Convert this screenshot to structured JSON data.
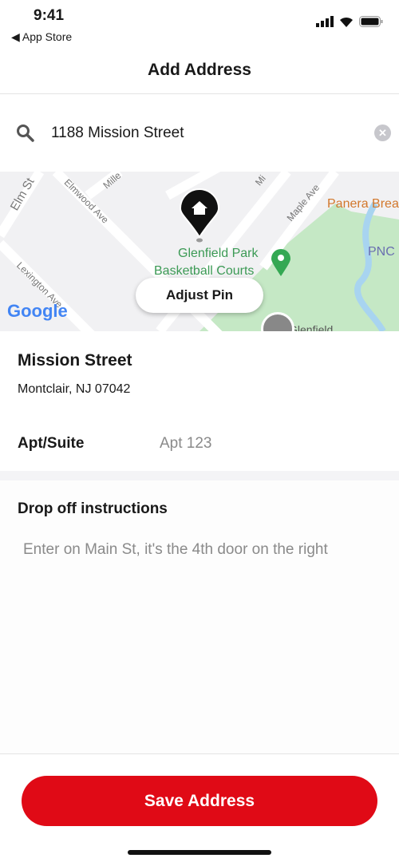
{
  "status": {
    "time": "9:41",
    "back": "◀ App Store"
  },
  "header": {
    "title": "Add Address"
  },
  "search": {
    "value": "1188 Mission Street",
    "clear": "✕"
  },
  "map": {
    "labels": [
      "Elm St",
      "Mille",
      "Elmwood Ave",
      "Mi",
      "Maple Ave",
      "Panera Brea",
      "PNC",
      "Lexington Ave",
      "Glenfield Park",
      "Basketball Courts",
      "Glenfield"
    ],
    "logo": "Google",
    "adjust_pin": "Adjust Pin"
  },
  "address": {
    "street": "Mission Street",
    "city": "Montclair, NJ 07042",
    "apt_label": "Apt/Suite",
    "apt_value": "Apt 123"
  },
  "dropoff": {
    "heading": "Drop off instructions",
    "text": "Enter on Main St, it's the 4th door on the right"
  },
  "footer": {
    "save": "Save Address"
  },
  "colors": {
    "accent": "#e00a16",
    "park": "#c5e8c5",
    "poi": "#34a853"
  }
}
